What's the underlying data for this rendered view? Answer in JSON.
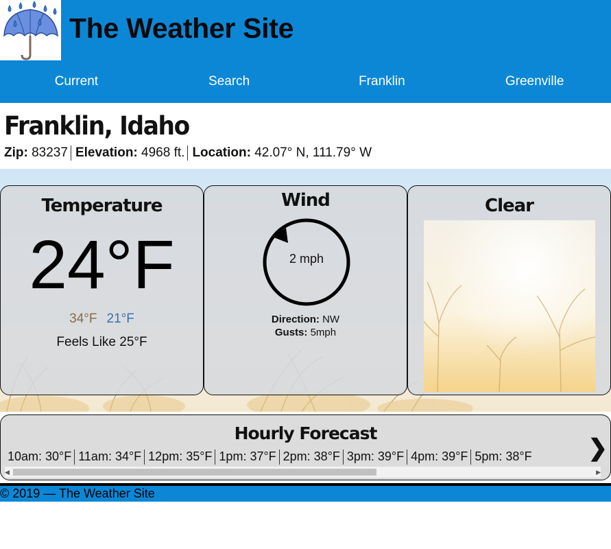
{
  "site": {
    "title": "The Weather Site",
    "logo_icon": "umbrella-rain-icon",
    "brand_color": "#0c87d6"
  },
  "nav": {
    "items": [
      "Current",
      "Search",
      "Franklin",
      "Greenville"
    ]
  },
  "location": {
    "name": "Franklin, Idaho",
    "zip_label": "Zip:",
    "zip": "83237",
    "elevation_label": "Elevation:",
    "elevation": "4968 ft.",
    "location_label": "Location:",
    "coords": "42.07° N, 111.79° W"
  },
  "temperature": {
    "title": "Temperature",
    "current": "24°F",
    "high": "34°F",
    "low": "21°F",
    "feels_like": "Feels Like 25°F"
  },
  "wind": {
    "title": "Wind",
    "speed": "2 mph",
    "direction_label": "Direction:",
    "direction": "NW",
    "gusts_label": "Gusts:",
    "gusts": "5mph"
  },
  "condition": {
    "title": "Clear"
  },
  "hourly": {
    "title": "Hourly Forecast",
    "items": [
      "10am: 30°F",
      "11am: 34°F",
      "12pm: 35°F",
      "1pm: 37°F",
      "2pm: 38°F",
      "3pm: 39°F",
      "4pm: 39°F",
      "5pm: 38°F"
    ],
    "next_icon": "chevron-right-icon"
  },
  "footer": {
    "text": "© 2019 — The Weather Site"
  }
}
